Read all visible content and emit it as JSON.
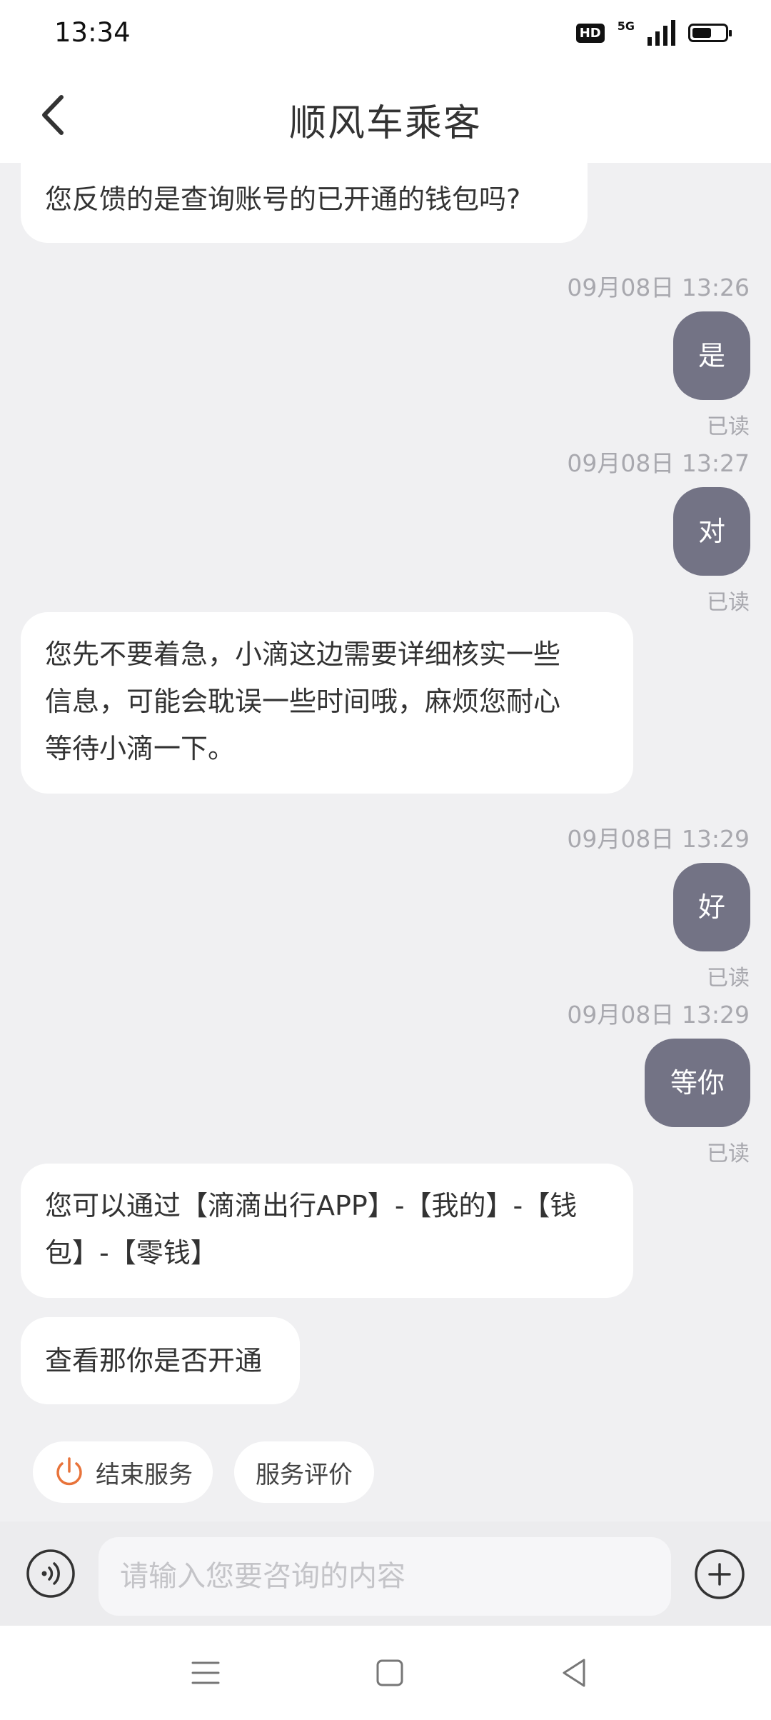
{
  "status_bar": {
    "time": "13:34",
    "badge": "HD",
    "network": "5G",
    "battery_level": 0.6
  },
  "header": {
    "title": "顺风车乘客",
    "back_icon": "chevron-left-icon"
  },
  "messages": [
    {
      "type": "agent",
      "text": "您反馈的是查询账号的已开通的钱包吗?"
    },
    {
      "type": "timestamp",
      "text": "09月08日 13:26"
    },
    {
      "type": "user",
      "text": "是",
      "status": "已读"
    },
    {
      "type": "timestamp",
      "text": "09月08日 13:27"
    },
    {
      "type": "user",
      "text": "对",
      "status": "已读"
    },
    {
      "type": "agent",
      "lines": [
        "您先不要着急，小滴这边需要详细核实一些",
        "信息，可能会耽误一些时间哦，麻烦您耐心",
        "等待小滴一下。"
      ]
    },
    {
      "type": "timestamp",
      "text": "09月08日 13:29"
    },
    {
      "type": "user",
      "text": "好",
      "status": "已读"
    },
    {
      "type": "timestamp",
      "text": "09月08日 13:29"
    },
    {
      "type": "user",
      "text": "等你",
      "status": "已读"
    },
    {
      "type": "agent",
      "lines": [
        "您可以通过【滴滴出行APP】-【我的】-【钱",
        "包】-【零钱】"
      ]
    },
    {
      "type": "agent",
      "text": "查看那你是否开通"
    }
  ],
  "quick_actions": {
    "end_service": "结束服务",
    "rate_service": "服务评价"
  },
  "input": {
    "placeholder": "请输入您要咨询的内容",
    "value": ""
  },
  "colors": {
    "user_bubble": "#737385",
    "accent_orange": "#e8733a",
    "background": "#f0f0f2"
  }
}
